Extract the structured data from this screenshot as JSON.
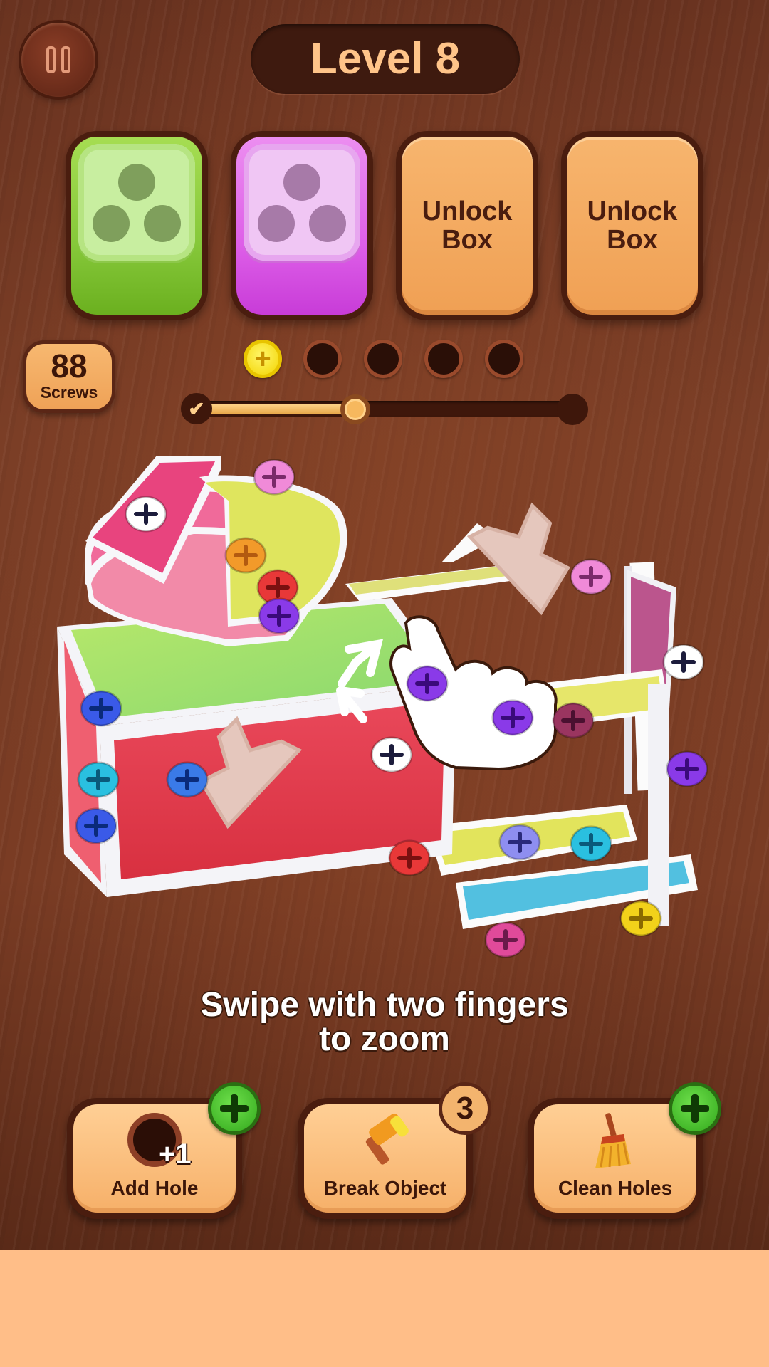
{
  "header": {
    "level_label": "Level 8"
  },
  "boxes": [
    {
      "kind": "green",
      "color": "#8bcc3c",
      "holes": 3
    },
    {
      "kind": "pink",
      "color": "#e066e8",
      "holes": 3
    },
    {
      "kind": "locked",
      "line1": "Unlock",
      "line2": "Box"
    },
    {
      "kind": "locked",
      "line1": "Unlock",
      "line2": "Box"
    }
  ],
  "screws": {
    "count": "88",
    "label": "Screws"
  },
  "hole_slots": {
    "total": 5,
    "filled": 1,
    "filled_color": "#f6de10"
  },
  "progress": {
    "fraction": 0.43
  },
  "hint": {
    "line1": "Swipe with two fingers",
    "line2": "to zoom"
  },
  "boosters": [
    {
      "label": "Add Hole",
      "icon": "hole-plus-one-icon",
      "icon_text": "+1",
      "badge": "plus"
    },
    {
      "label": "Break Object",
      "icon": "hammer-icon",
      "badge": "count",
      "count": "3"
    },
    {
      "label": "Clean Holes",
      "icon": "broom-icon",
      "badge": "plus"
    }
  ],
  "colors": {
    "wood": "#7a3c24",
    "panel": "#f6b069",
    "accent_green": "#32a81c",
    "bottom_area": "#ffbe88"
  }
}
